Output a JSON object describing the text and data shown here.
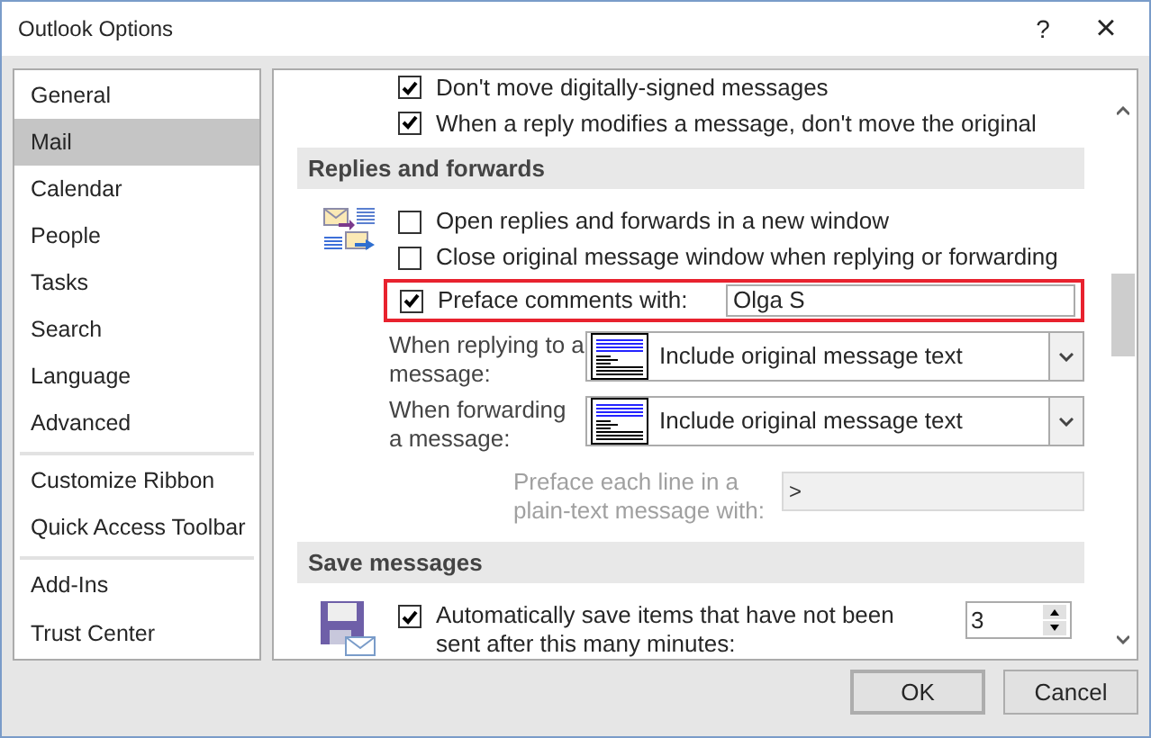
{
  "window": {
    "title": "Outlook Options",
    "help": "?",
    "close": "×"
  },
  "sidebar": {
    "groups": [
      [
        {
          "label": "General",
          "selected": false
        },
        {
          "label": "Mail",
          "selected": true
        },
        {
          "label": "Calendar",
          "selected": false
        },
        {
          "label": "People",
          "selected": false
        },
        {
          "label": "Tasks",
          "selected": false
        },
        {
          "label": "Search",
          "selected": false
        },
        {
          "label": "Language",
          "selected": false
        },
        {
          "label": "Advanced",
          "selected": false
        }
      ],
      [
        {
          "label": "Customize Ribbon",
          "selected": false
        },
        {
          "label": "Quick Access Toolbar",
          "selected": false
        }
      ],
      [
        {
          "label": "Add-Ins",
          "selected": false
        },
        {
          "label": "Trust Center",
          "selected": false
        }
      ]
    ]
  },
  "top_options": [
    {
      "label": "Don't move digitally-signed messages",
      "checked": true
    },
    {
      "label": "When a reply modifies a message, don't move the original",
      "checked": true
    }
  ],
  "replies": {
    "heading": "Replies and forwards",
    "options": [
      {
        "label": "Open replies and forwards in a new window",
        "checked": false
      },
      {
        "label": "Close original message window when replying or forwarding",
        "checked": false
      }
    ],
    "preface": {
      "label": "Preface comments with:",
      "checked": true,
      "value": "Olga S",
      "highlighted": true
    },
    "dropdowns": [
      {
        "label": "When replying to a message:",
        "value": "Include original message text"
      },
      {
        "label": "When forwarding a message:",
        "value": "Include original message text"
      }
    ],
    "prefix": {
      "label": "Preface each line in a plain-text message with:",
      "value": ">",
      "disabled": true
    }
  },
  "save": {
    "heading": "Save messages",
    "option": {
      "label": "Automatically save items that have not been sent after this many minutes:",
      "checked": true,
      "value": "3"
    }
  },
  "buttons": [
    "OK",
    "Cancel"
  ]
}
